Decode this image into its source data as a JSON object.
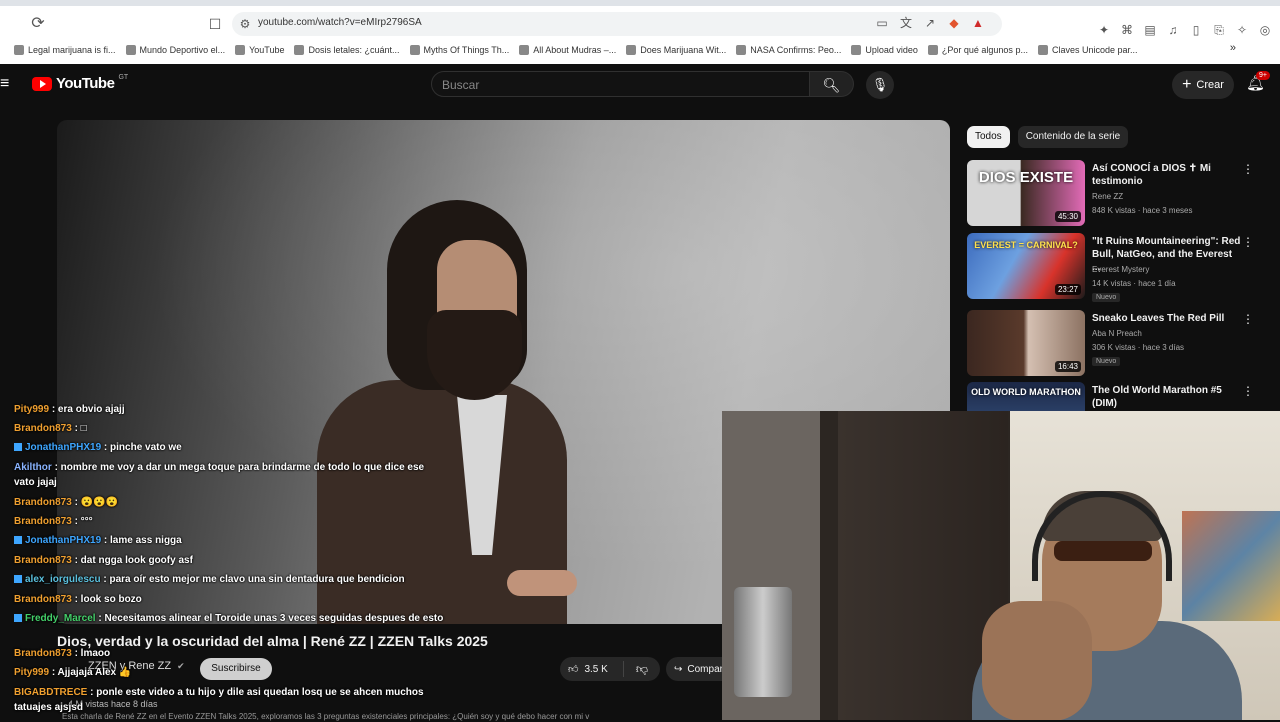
{
  "browser": {
    "url": "youtube.com/watch?v=eMIrp2796SA",
    "bookmarks": [
      "Legal marijuana is fi...",
      "Mundo Deportivo el...",
      "YouTube",
      "Dosis letales: ¿cuánt...",
      "Myths Of Things Th...",
      "All About Mudras –...",
      "Does Marijuana Wit...",
      "NASA Confirms: Peo...",
      "Upload video",
      "¿Por qué algunos p...",
      "Claves Unicode par..."
    ]
  },
  "header": {
    "logo_text": "YouTube",
    "country_code": "GT",
    "search_placeholder": "Buscar",
    "create_label": "Crear",
    "notifications_badge": "9+"
  },
  "video": {
    "title": "Dios, verdad y la oscuridad del alma | René ZZ | ZZEN Talks 2025",
    "channel": "ZZEN y Rene ZZ",
    "subscribe_label": "Suscribirse",
    "likes": "3.5 K",
    "share_label": "Compartir",
    "views": "4 M vistas  hace 8 días",
    "description": "Esta charla de René ZZ en el Evento ZZEN Talks 2025, exploramos las 3 preguntas existenciales principales: ¿Quién soy y qué debo hacer con mi v"
  },
  "chat": [
    {
      "user": "Pity999",
      "text": ": era obvio ajajj",
      "color": "u-orange",
      "badge": false
    },
    {
      "user": "Brandon873",
      "text": ": □",
      "color": "u-orange",
      "badge": false
    },
    {
      "user": "JonathanPHX19",
      "text": ": pinche vato we",
      "color": "u-blue",
      "badge": true
    },
    {
      "user": "Akilthor",
      "text": ": nombre me voy a dar un mega toque para brindarme de todo lo que dice ese vato jajaj",
      "color": "u-violet",
      "badge": false
    },
    {
      "user": "Brandon873",
      "text": ": 😮😮😮",
      "color": "u-orange",
      "badge": false
    },
    {
      "user": "Brandon873",
      "text": ": °°°",
      "color": "u-orange",
      "badge": false
    },
    {
      "user": "JonathanPHX19",
      "text": ": lame ass nigga",
      "color": "u-blue",
      "badge": true
    },
    {
      "user": "Brandon873",
      "text": ": dat ngga look goofy asf",
      "color": "u-orange",
      "badge": false
    },
    {
      "user": "alex_iorgulescu",
      "text": ": para oír esto mejor me clavo una sin dentadura que bendicion",
      "color": "u-cyan",
      "badge": true
    },
    {
      "user": "Brandon873",
      "text": ": look so bozo",
      "color": "u-orange",
      "badge": false
    },
    {
      "user": "Freddy_Marcel",
      "text": ": Necesitamos alinear el Toroide unas 3 veces seguidas despues de esto",
      "color": "u-green",
      "badge": true
    },
    {
      "user": "Brandon873",
      "text": ": lmaoo",
      "color": "u-orange",
      "badge": false
    },
    {
      "user": "Pity999",
      "text": ": Ajjajaja Alex 👍",
      "color": "u-orange",
      "badge": false
    },
    {
      "user": "BIGABDTRECE",
      "text": ": ponle este video a tu hijo y dile asi quedan losq ue se ahcen muchos tatuajes ajsjsd",
      "color": "u-orange",
      "badge": false
    }
  ],
  "sidebar": {
    "chips": [
      "Todos",
      "Contenido de la serie"
    ],
    "recommendations": [
      {
        "title": "Así CONOCÍ a DIOS ✝ Mi testimonio",
        "channel": "Rene ZZ",
        "meta": "848 K vistas · hace 3 meses",
        "duration": "45:30",
        "badge": "",
        "thumb_text": "DIOS EXISTE"
      },
      {
        "title": "\"It Ruins Mountaineering\": Red Bull, NatGeo, and the Everest ...",
        "channel": "Everest Mystery",
        "meta": "14 K vistas · hace 1 día",
        "duration": "23:27",
        "badge": "Nuevo",
        "thumb_text": "EVEREST = CARNIVAL?"
      },
      {
        "title": "Sneako Leaves The Red Pill",
        "channel": "Aba N Preach",
        "meta": "306 K vistas · hace 3 días",
        "duration": "16:43",
        "badge": "Nuevo",
        "thumb_text": ""
      },
      {
        "title": "The Old World Marathon #5 (DIM)",
        "channel": "",
        "meta": "",
        "duration": "",
        "badge": "",
        "thumb_text": "OLD WORLD MARATHON"
      }
    ]
  },
  "colors": {
    "brand_red": "#ff0000",
    "accent_blue": "#3ea6ff",
    "bg": "#0f0f0f"
  },
  "icons": [
    "reload-icon",
    "bookmark-icon",
    "tune-icon",
    "search-icon",
    "mic-icon",
    "bell-icon",
    "plus-icon",
    "like-icon",
    "dislike-icon",
    "share-icon",
    "kebab-icon"
  ]
}
